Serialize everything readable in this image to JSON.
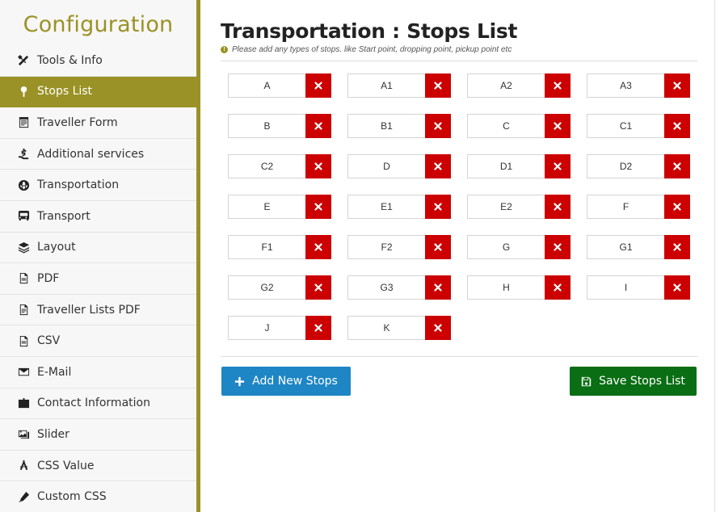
{
  "sidebar": {
    "title": "Configuration",
    "items": [
      {
        "label": "Tools & Info",
        "icon": "tools-icon",
        "active": false
      },
      {
        "label": "Stops List",
        "icon": "map-pin-icon",
        "active": true
      },
      {
        "label": "Traveller Form",
        "icon": "form-icon",
        "active": false
      },
      {
        "label": "Additional services",
        "icon": "services-icon",
        "active": false
      },
      {
        "label": "Transportation",
        "icon": "globe-icon",
        "active": false
      },
      {
        "label": "Transport",
        "icon": "bus-icon",
        "active": false
      },
      {
        "label": "Layout",
        "icon": "layers-icon",
        "active": false
      },
      {
        "label": "PDF",
        "icon": "pdf-icon",
        "active": false
      },
      {
        "label": "Traveller Lists PDF",
        "icon": "file-icon",
        "active": false
      },
      {
        "label": "CSV",
        "icon": "csv-icon",
        "active": false
      },
      {
        "label": "E-Mail",
        "icon": "envelope-icon",
        "active": false
      },
      {
        "label": "Contact Information",
        "icon": "contact-card-icon",
        "active": false
      },
      {
        "label": "Slider",
        "icon": "images-icon",
        "active": false
      },
      {
        "label": "CSS Value",
        "icon": "compass-icon",
        "active": false
      },
      {
        "label": "Custom CSS",
        "icon": "pen-icon",
        "active": false
      }
    ]
  },
  "main": {
    "title": "Transportation : Stops List",
    "subtitle": "Please add any types of stops. like Start point, dropping point, pickup point etc",
    "stops": [
      "A",
      "A1",
      "A2",
      "A3",
      "B",
      "B1",
      "C",
      "C1",
      "C2",
      "D",
      "D1",
      "D2",
      "E",
      "E1",
      "E2",
      "F",
      "F1",
      "F2",
      "G",
      "G1",
      "G2",
      "G3",
      "H",
      "I",
      "J",
      "K"
    ],
    "add_button_label": "Add New Stops",
    "save_button_label": "Save Stops List"
  },
  "colors": {
    "accent": "#9a9226",
    "delete": "#cc0000",
    "add": "#1e86c4",
    "save": "#0a6e14"
  }
}
